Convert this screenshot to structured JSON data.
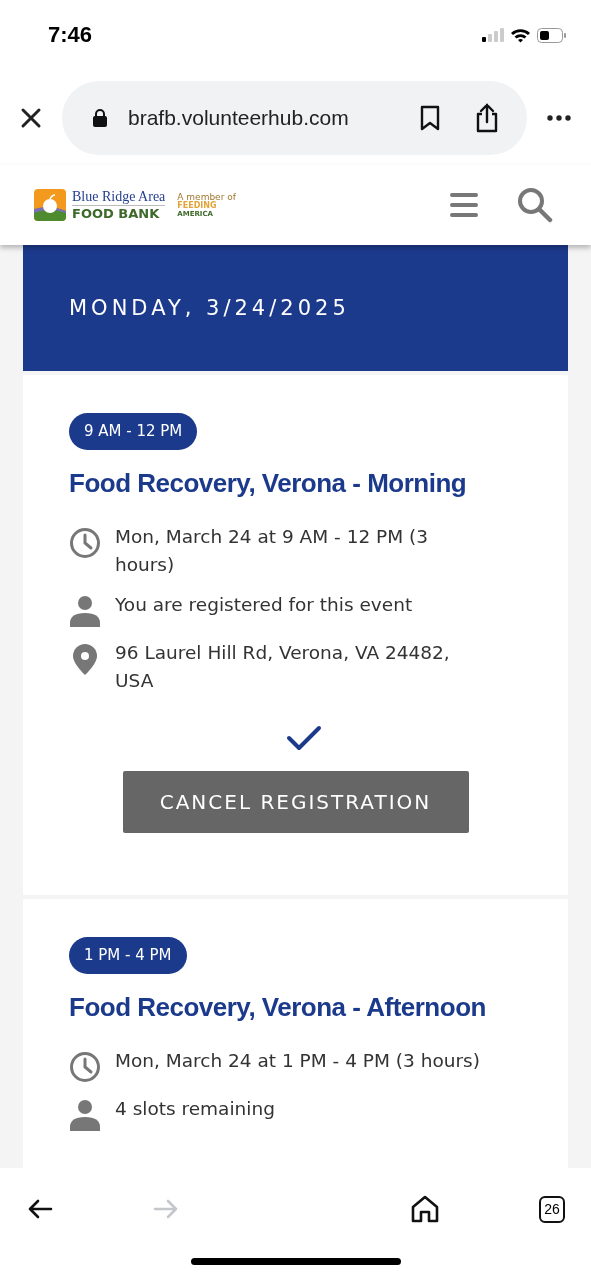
{
  "status_bar": {
    "time": "7:46"
  },
  "browser": {
    "url": "brafb.volunteerhub.com",
    "forward_disabled": true,
    "tab_count": "26"
  },
  "site_header": {
    "logo": {
      "line_1": "Blue Ridge Area",
      "line_2": "FOOD BANK",
      "partner_tagline": "A member of",
      "partner_line_1": "FEEDING",
      "partner_line_2": "AMERICA"
    }
  },
  "date_header": "MONDAY, 3/24/2025",
  "events": [
    {
      "time_badge": "9 AM - 12 PM",
      "title": "Food Recovery, Verona - Morning",
      "details": [
        {
          "kind": "time",
          "text": "Mon, March 24 at 9 AM - 12 PM (3 hours)"
        },
        {
          "kind": "person",
          "text": "You are registered for this event"
        },
        {
          "kind": "location",
          "text": "96 Laurel Hill Rd, Verona, VA 24482, USA"
        }
      ],
      "registered": true,
      "action_button": "CANCEL REGISTRATION"
    },
    {
      "time_badge": "1 PM - 4 PM",
      "title": "Food Recovery, Verona - Afternoon",
      "details": [
        {
          "kind": "time",
          "text": "Mon, March 24 at 1 PM - 4 PM (3 hours)"
        },
        {
          "kind": "person",
          "text": "4 slots remaining"
        }
      ],
      "registered": false
    }
  ]
}
